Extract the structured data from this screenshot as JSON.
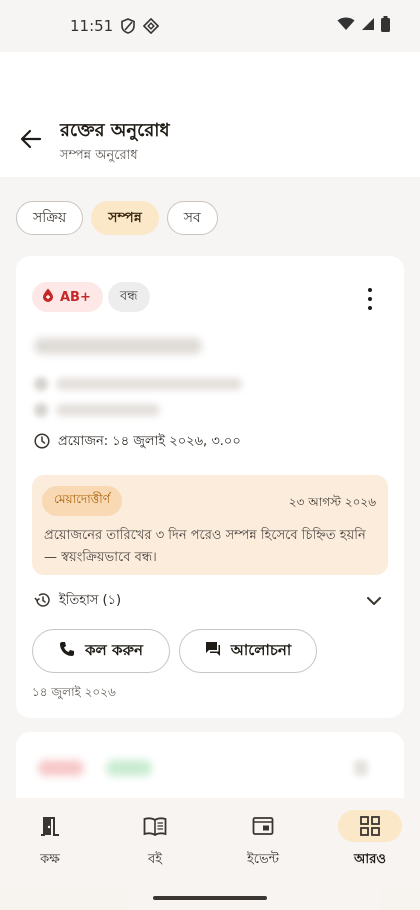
{
  "status_bar": {
    "time": "11:51"
  },
  "header": {
    "title": "রক্তের অনুরোধ",
    "subtitle": "সম্পন্ন অনুরোধ"
  },
  "filters": [
    {
      "label": "সক্রিয়"
    },
    {
      "label": "সম্পন্ন",
      "selected": true
    },
    {
      "label": "সব"
    }
  ],
  "request_card": {
    "blood_group": "AB+",
    "status": "বন্ধ",
    "needed_by": "প্রয়োজন: ১৪ জুলাই ২০২৬, ৩.০০",
    "notice": {
      "badge": "মেয়াদোত্তীর্ণ",
      "date": "২৩ আগস্ট ২০২৬",
      "text": "প্রয়োজনের তারিখের ৩ দিন পরেও সম্পন্ন হিসেবে চিহ্নিত হয়নি — স্বয়ংক্রিয়ভাবে বন্ধ।"
    },
    "history_label": "ইতিহাস (১)",
    "call_label": "কল করুন",
    "discuss_label": "আলোচনা",
    "created_date": "১৪ জুলাই ২০২৬"
  },
  "bottom_nav": [
    {
      "label": "কক্ষ",
      "icon": "door-icon"
    },
    {
      "label": "বই",
      "icon": "book-icon"
    },
    {
      "label": "ইভেন্ট",
      "icon": "event-icon"
    },
    {
      "label": "আরও",
      "icon": "grid-icon",
      "active": true
    }
  ],
  "colors": {
    "accent_bg": "#fbe8c8",
    "blood_red": "#c62828",
    "expired_orange": "#a85d00"
  }
}
